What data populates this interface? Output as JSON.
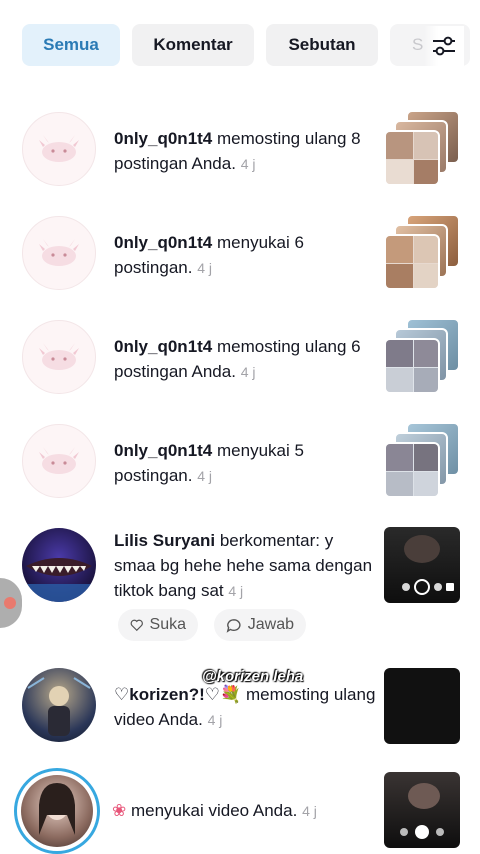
{
  "tabs": [
    {
      "label": "Semua",
      "active": true
    },
    {
      "label": "Komentar",
      "active": false
    },
    {
      "label": "Sebutan",
      "active": false
    },
    {
      "label": "S",
      "active": false
    }
  ],
  "filter_icon": "sliders-icon",
  "notifications": [
    {
      "user": "0nly_q0n1t4",
      "action": "memosting ulang 8 postingan Anda.",
      "time": "4 j",
      "avatar": "pink-axolotl"
    },
    {
      "user": "0nly_q0n1t4",
      "action": "menyukai 6 postingan.",
      "time": "4 j",
      "avatar": "pink-axolotl"
    },
    {
      "user": "0nly_q0n1t4",
      "action": "memosting ulang 6 postingan Anda.",
      "time": "4 j",
      "avatar": "pink-axolotl"
    },
    {
      "user": "0nly_q0n1t4",
      "action": "menyukai 5 postingan.",
      "time": "4 j",
      "avatar": "pink-axolotl"
    },
    {
      "user": "Lilis Suryani",
      "action": "berkomentar: y smaa bg hehe hehe sama dengan tiktok bang sat",
      "time": "4 j",
      "avatar": "shark-photo"
    },
    {
      "user": "♡korizen?!♡",
      "action": "memosting ulang video Anda.",
      "time": "4 j",
      "avatar": "concert-photo"
    },
    {
      "user": "",
      "action": "menyukai video Anda.",
      "time": "4 j",
      "avatar": "girl-photo"
    }
  ],
  "comment_actions": {
    "like": "Suka",
    "reply": "Jawab"
  },
  "watermark": "@korizen leha"
}
